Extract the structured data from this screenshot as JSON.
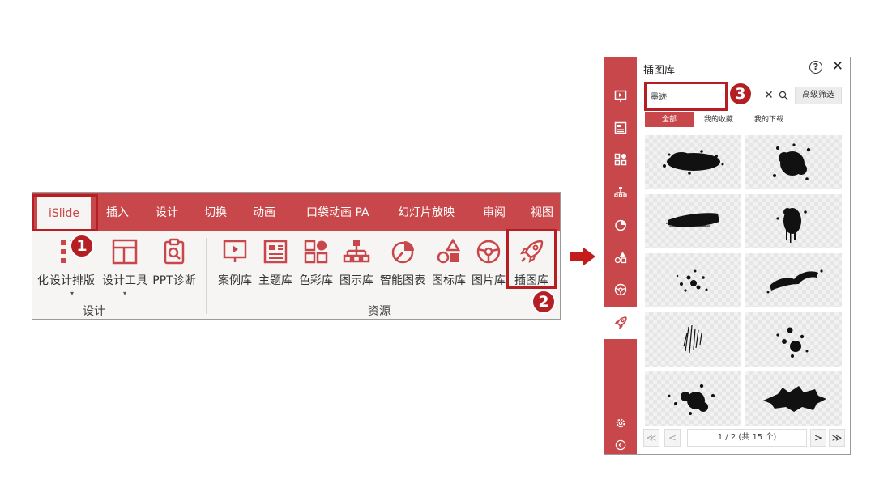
{
  "ribbon": {
    "tabs": [
      {
        "label": "iSlide"
      },
      {
        "label": "插入"
      },
      {
        "label": "设计"
      },
      {
        "label": "切换"
      },
      {
        "label": "动画"
      },
      {
        "label": "口袋动画 PA"
      },
      {
        "label": "幻灯片放映"
      },
      {
        "label": "审阅"
      },
      {
        "label": "视图"
      }
    ],
    "buttons": [
      {
        "label": "化"
      },
      {
        "label": "设计排版",
        "icon": "layout-grid-icon"
      },
      {
        "label": "设计工具",
        "icon": "window-layout-icon"
      },
      {
        "label": "PPT诊断",
        "icon": "clipboard-search-icon"
      },
      {
        "label": "案例库",
        "icon": "presentation-board-icon"
      },
      {
        "label": "主题库",
        "icon": "theme-document-icon"
      },
      {
        "label": "色彩库",
        "icon": "color-palette-icon"
      },
      {
        "label": "图示库",
        "icon": "org-chart-icon"
      },
      {
        "label": "智能图表",
        "icon": "pie-chart-icon"
      },
      {
        "label": "图标库",
        "icon": "shapes-icon"
      },
      {
        "label": "图片库",
        "icon": "aperture-icon"
      },
      {
        "label": "插图库",
        "icon": "rocket-icon"
      }
    ],
    "caret": "▾",
    "groups": {
      "design": "设计",
      "resources": "资源"
    }
  },
  "badges": {
    "one": "1",
    "two": "2",
    "three": "3"
  },
  "panel": {
    "title": "插图库",
    "help": "?",
    "close": "✕",
    "search": {
      "value": "墨迹",
      "clear": "✕"
    },
    "advanced_filter": "高级筛选",
    "filter_tabs": [
      {
        "label": "全部",
        "active": true
      },
      {
        "label": "我的收藏"
      },
      {
        "label": "我的下载"
      }
    ],
    "sidebar_icons": [
      "case-library-icon",
      "theme-library-icon",
      "color-library-icon",
      "diagram-library-icon",
      "smart-chart-icon",
      "icon-library-icon",
      "picture-library-icon",
      "illustration-library-icon",
      "settings-icon",
      "collapse-icon"
    ],
    "pager": {
      "first": "≪",
      "prev": "<",
      "text": "1 / 2 (共 15 个)",
      "next": ">",
      "last": "≫"
    }
  },
  "colors": {
    "accent": "#c8474a",
    "highlight": "#b51f24"
  }
}
